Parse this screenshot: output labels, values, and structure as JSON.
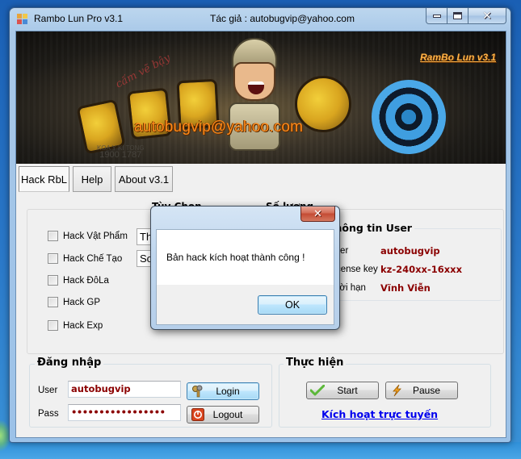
{
  "window": {
    "title": "Rambo Lun Pro v3.1",
    "author_caption": "Tác giả  : autobugvip@yahoo.com",
    "controls": {
      "minimize": "minimize",
      "maximize": "maximize",
      "close": "close"
    }
  },
  "banner": {
    "email": "autobugvip@yahoo.com",
    "version_link": "RamBo Lun v3.1",
    "scrawl": "cấm vẽ bậy",
    "phone_caption": "KOA Y KI TONG",
    "phone_number": "1900 1787"
  },
  "tabs": [
    {
      "label": "Hack RbL",
      "active": true
    },
    {
      "label": "Help",
      "active": false
    },
    {
      "label": "About v3.1",
      "active": false
    }
  ],
  "hack_options": {
    "column_option_label": "Tùy Chọn",
    "column_quantity_label": "Số lượng",
    "checkboxes": [
      {
        "label": "Hack Vật Phẩm",
        "checked": false
      },
      {
        "label": "Hack Chế Tạo",
        "checked": false
      },
      {
        "label": "Hack ĐôLa",
        "checked": false
      },
      {
        "label": "Hack GP",
        "checked": false
      },
      {
        "label": "Hack Exp",
        "checked": false
      }
    ],
    "combos": [
      {
        "value": "Th"
      },
      {
        "value": "So"
      }
    ]
  },
  "user_info": {
    "title": "Thông tin User",
    "rows": [
      {
        "label": "User",
        "value": "autobugvip"
      },
      {
        "label": "License key",
        "value": "kz-240xx-16xxx"
      },
      {
        "label": "Thời hạn",
        "value": "Vĩnh Viễn"
      }
    ]
  },
  "login": {
    "title": "Đăng nhập",
    "user_label": "User",
    "user_value": "autobugvip",
    "pass_label": "Pass",
    "pass_value": "•••••••••••••••••",
    "login_button": "Login",
    "logout_button": "Logout"
  },
  "execute": {
    "title": "Thực hiện",
    "start_button": "Start",
    "pause_button": "Pause",
    "activate_link": "Kích hoạt trực tuyến"
  },
  "dialog": {
    "message": "Bản hack kích hoạt thành công !",
    "ok_button": "OK"
  },
  "colors": {
    "value_red": "#8b0000",
    "link_blue": "#0000ee",
    "banner_email_orange": "#ff8a1a"
  }
}
